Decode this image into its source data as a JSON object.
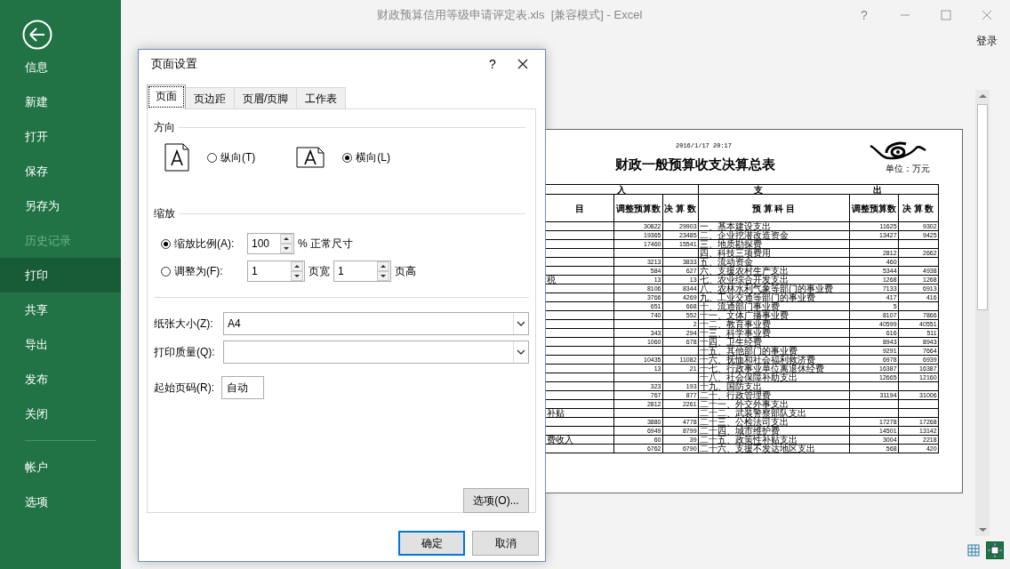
{
  "window": {
    "title": "财政预算信用等级申请评定表.xls  [兼容模式] - Excel",
    "help": "?",
    "sign_in": "登录"
  },
  "backstage": {
    "items": [
      {
        "label": "信息",
        "selected": false,
        "disabled": false
      },
      {
        "label": "新建",
        "selected": false,
        "disabled": false
      },
      {
        "label": "打开",
        "selected": false,
        "disabled": false
      },
      {
        "label": "保存",
        "selected": false,
        "disabled": false
      },
      {
        "label": "另存为",
        "selected": false,
        "disabled": false
      },
      {
        "label": "历史记录",
        "selected": false,
        "disabled": true
      },
      {
        "label": "打印",
        "selected": true,
        "disabled": false
      },
      {
        "label": "共享",
        "selected": false,
        "disabled": false
      },
      {
        "label": "导出",
        "selected": false,
        "disabled": false
      },
      {
        "label": "发布",
        "selected": false,
        "disabled": false
      },
      {
        "label": "关闭",
        "selected": false,
        "disabled": false
      }
    ],
    "footer_items": [
      {
        "label": "帐户",
        "selected": false,
        "disabled": false
      },
      {
        "label": "选项",
        "selected": false,
        "disabled": false
      }
    ]
  },
  "dialog": {
    "title": "页面设置",
    "help": "?",
    "tabs": [
      {
        "label": "页面",
        "selected": true
      },
      {
        "label": "页边距",
        "selected": false
      },
      {
        "label": "页眉/页脚",
        "selected": false
      },
      {
        "label": "工作表",
        "selected": false
      }
    ],
    "orientation": {
      "heading": "方向",
      "options": [
        {
          "label": "纵向(T)",
          "kind": "portrait",
          "selected": false
        },
        {
          "label": "横向(L)",
          "kind": "landscape",
          "selected": true
        }
      ]
    },
    "scaling": {
      "heading": "缩放",
      "options": [
        {
          "label": "缩放比例(A):",
          "selected": true
        },
        {
          "label": "调整为(F):",
          "selected": false
        }
      ],
      "percent": "100",
      "percent_suffix": "% 正常尺寸",
      "pages_wide": "1",
      "pages_wide_label": "页宽",
      "pages_tall": "1",
      "pages_tall_label": "页高"
    },
    "paper_size": {
      "label": "纸张大小(Z):",
      "value": "A4"
    },
    "print_quality": {
      "label": "打印质量(Q):"
    },
    "first_page": {
      "label": "起始页码(R):",
      "value": "自动"
    },
    "options_button": "选项(O)...",
    "buttons": [
      {
        "label": "确定",
        "default": true
      },
      {
        "label": "取消",
        "default": false
      }
    ]
  },
  "preview": {
    "timestamp": "2016/1/17 20:17",
    "title": "财政一般预算收支决算总表",
    "unit": "单位：万元",
    "header": {
      "income_section": "入",
      "expense_section_1": "支",
      "expense_section_2": "出",
      "columns": [
        "目",
        "调整预算数",
        "决 算 数",
        "预 算 科 目",
        "调整预算数",
        "决 算 数"
      ]
    },
    "rows": [
      {
        "income_adjusted": "30822",
        "income_final": "29903",
        "expense_item": "一、基本建设支出",
        "expense_adjusted": "11625",
        "expense_final": "9302"
      },
      {
        "income_adjusted": "19365",
        "income_final": "23485",
        "expense_item": "二、企业挖潜改造资金",
        "expense_adjusted": "13427",
        "expense_final": "9425"
      },
      {
        "income_adjusted": "17460",
        "income_final": "15541",
        "expense_item": "三、地质勘探费"
      },
      {
        "expense_item": "四、科技三项费用",
        "expense_adjusted": "2812",
        "expense_final": "2662"
      },
      {
        "income_adjusted": "3213",
        "income_final": "3833",
        "expense_item": "五、流动资金",
        "expense_adjusted": "460"
      },
      {
        "income_adjusted": "584",
        "income_final": "627",
        "expense_item": "六、支援农村生产支出",
        "expense_adjusted": "5344",
        "expense_final": "4938"
      },
      {
        "income_item": "税",
        "income_adjusted": "13",
        "income_final": "13",
        "expense_item": "七、农业综合开发支出",
        "expense_adjusted": "1268",
        "expense_final": "1268"
      },
      {
        "income_adjusted": "8106",
        "income_final": "8344",
        "expense_item": "八、农林水利气象等部门的事业费",
        "expense_adjusted": "7133",
        "expense_final": "6913"
      },
      {
        "income_adjusted": "3766",
        "income_final": "4269",
        "expense_item": "九、工业交通等部门的事业费",
        "expense_adjusted": "417",
        "expense_final": "416"
      },
      {
        "income_adjusted": "651",
        "income_final": "668",
        "expense_item": "十、流通部门事业费",
        "expense_adjusted": "5"
      },
      {
        "income_adjusted": "740",
        "income_final": "552",
        "expense_item": "十一、文体广播事业费",
        "expense_adjusted": "8107",
        "expense_final": "7866"
      },
      {
        "income_final": "2",
        "expense_item": "十二、教育事业费",
        "expense_adjusted": "40599",
        "expense_final": "40551"
      },
      {
        "income_adjusted": "343",
        "income_final": "294",
        "expense_item": "十三、科学事业费",
        "expense_adjusted": "616",
        "expense_final": "511"
      },
      {
        "income_adjusted": "1060",
        "income_final": "678",
        "expense_item": "十四、卫生经费",
        "expense_adjusted": "8943",
        "expense_final": "8943"
      },
      {
        "expense_item": "十五、其他部门的事业费",
        "expense_adjusted": "9291",
        "expense_final": "7664"
      },
      {
        "income_adjusted": "10435",
        "income_final": "11082",
        "expense_item": "十六、抚恤和社会福利救济费",
        "expense_adjusted": "6978",
        "expense_final": "6939"
      },
      {
        "income_adjusted": "13",
        "income_final": "21",
        "expense_item": "十七、行政事业单位离退休经费",
        "expense_adjusted": "16387",
        "expense_final": "16387"
      },
      {
        "expense_item": "十八、社会保障补助支出",
        "expense_adjusted": "12665",
        "expense_final": "12160"
      },
      {
        "income_adjusted": "323",
        "income_final": "193",
        "expense_item": "十九、国防支出"
      },
      {
        "income_adjusted": "767",
        "income_final": "877",
        "expense_item": "二十、行政管理费",
        "expense_adjusted": "31194",
        "expense_final": "31006"
      },
      {
        "income_adjusted": "2812",
        "income_final": "2261",
        "expense_item": "二十一、外交外事支出"
      },
      {
        "income_item": "补贴",
        "expense_item": "二十二、武装警察部队支出"
      },
      {
        "income_adjusted": "3880",
        "income_final": "4778",
        "expense_item": "二十三、公检法司支出",
        "expense_adjusted": "17278",
        "expense_final": "17268"
      },
      {
        "income_adjusted": "6949",
        "income_final": "8799",
        "expense_item": "二十四、城市维护费",
        "expense_adjusted": "14501",
        "expense_final": "13142"
      },
      {
        "income_item": "费收入",
        "income_adjusted": "60",
        "income_final": "39",
        "expense_item": "二十五、政策性补贴支出",
        "expense_adjusted": "3004",
        "expense_final": "2218"
      },
      {
        "income_adjusted": "6762",
        "income_final": "6790",
        "expense_item": "二十六、支援不发达地区支出",
        "expense_adjusted": "568",
        "expense_final": "420"
      }
    ]
  },
  "view_buttons": [
    {
      "kind": "normal",
      "selected": false
    },
    {
      "kind": "fit_page",
      "selected": true
    }
  ]
}
